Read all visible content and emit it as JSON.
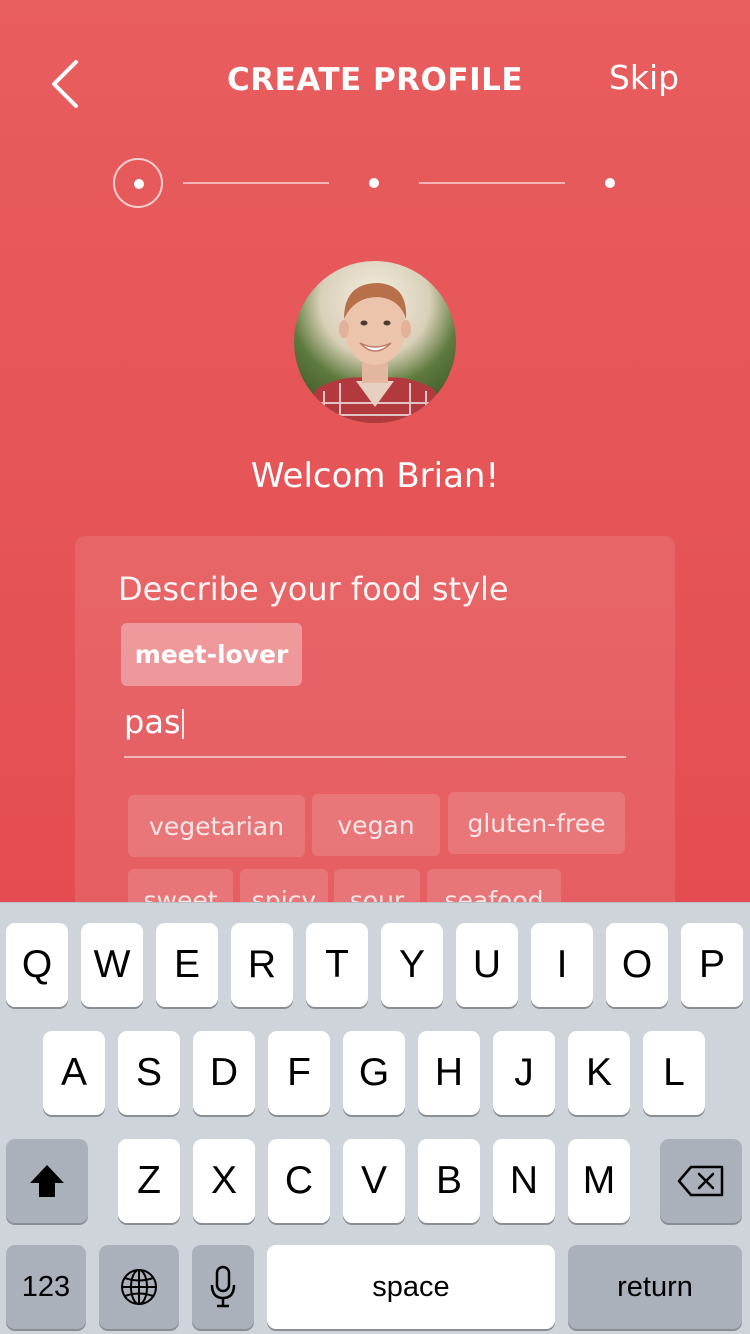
{
  "header": {
    "title": "CREATE PROFILE",
    "skip_label": "Skip"
  },
  "stepper": {
    "current_step": 1,
    "total_steps": 3
  },
  "welcome": "Welcom Brian!",
  "food_style": {
    "label": "Describe your food style",
    "selected_tags": [
      "meet-lover"
    ],
    "input_value": "pas",
    "suggestions": [
      "vegetarian",
      "vegan",
      "gluten-free",
      "sweet",
      "spicy",
      "sour",
      "seafood"
    ]
  },
  "keyboard": {
    "row1": [
      "Q",
      "W",
      "E",
      "R",
      "T",
      "Y",
      "U",
      "I",
      "O",
      "P"
    ],
    "row2": [
      "A",
      "S",
      "D",
      "F",
      "G",
      "H",
      "J",
      "K",
      "L"
    ],
    "row3": [
      "Z",
      "X",
      "C",
      "V",
      "B",
      "N",
      "M"
    ],
    "numbers_label": "123",
    "space_label": "space",
    "return_label": "return",
    "icons": [
      "shift-icon",
      "backspace-icon",
      "globe-icon",
      "microphone-icon"
    ]
  }
}
